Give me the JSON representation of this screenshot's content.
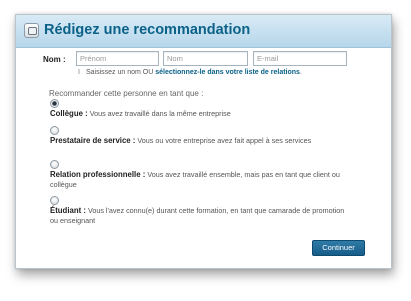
{
  "header": {
    "title": "Rédigez une recommandation",
    "icon": "recommendation-icon"
  },
  "name_row": {
    "label": "Nom :",
    "first_placeholder": "Prénom",
    "last_placeholder": "Nom",
    "email_placeholder": "E-mail"
  },
  "hint": {
    "bar": "I",
    "text": "Saisissez un nom OU",
    "link": "sélectionnez-le dans votre liste de relations",
    "end": "."
  },
  "section_title": "Recommander cette personne en tant que :",
  "options": [
    {
      "title": "Collègue :",
      "desc": "Vous avez travaillé dans la même entreprise",
      "checked": true
    },
    {
      "title": "Prestataire de service :",
      "desc": "Vous ou votre entreprise avez fait appel à ses services",
      "checked": false
    },
    {
      "title": "Relation professionnelle :",
      "desc": "Vous avez travaillé ensemble, mais pas en tant que client ou collègue",
      "checked": false
    },
    {
      "title": "Étudiant :",
      "desc": "Vous l'avez connu(e) durant cette formation, en tant que camarade de promotion ou enseignant",
      "checked": false
    }
  ],
  "continue_button": "Continuer",
  "colors": {
    "accent": "#0b6188",
    "header_bg": "#c8e1f0",
    "button_bg": "#1f6b98"
  }
}
